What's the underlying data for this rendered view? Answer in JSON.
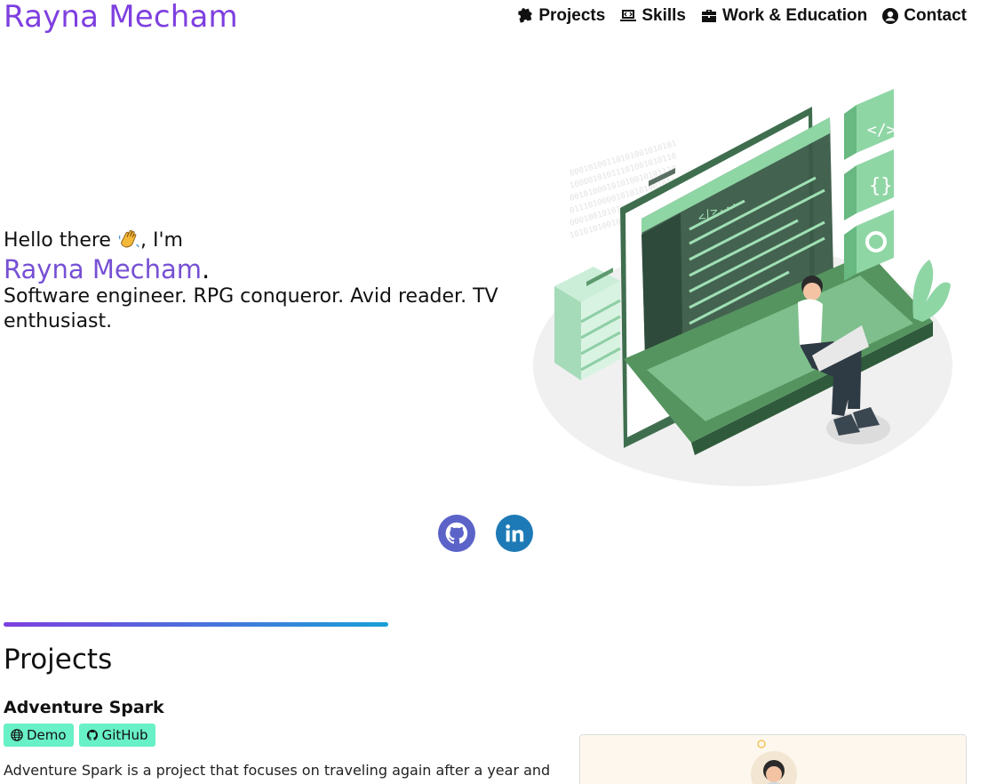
{
  "header": {
    "brand": "Rayna Mecham",
    "nav": [
      {
        "label": "Projects",
        "icon": "puzzle-icon"
      },
      {
        "label": "Skills",
        "icon": "laptop-code-icon"
      },
      {
        "label": "Work & Education",
        "icon": "briefcase-icon"
      },
      {
        "label": "Contact",
        "icon": "user-circle-icon"
      }
    ]
  },
  "hero": {
    "greeting": "Hello there",
    "greeting_suffix": ", I'm",
    "name": "Rayna Mecham",
    "name_suffix": ".",
    "tagline": "Software engineer. RPG conqueror. Avid reader. TV enthusiast."
  },
  "socials": [
    {
      "name": "GitHub",
      "icon": "github-icon",
      "color": "#5b63c9"
    },
    {
      "name": "LinkedIn",
      "icon": "linkedin-icon",
      "color": "#1d7ab6"
    }
  ],
  "projects": {
    "title": "Projects",
    "items": [
      {
        "title": "Adventure Spark",
        "buttons": [
          {
            "label": "Demo",
            "icon": "globe-icon"
          },
          {
            "label": "GitHub",
            "icon": "github-icon"
          }
        ],
        "description": "Adventure Spark is a project that focuses on traveling again after a year and a"
      }
    ]
  },
  "colors": {
    "brand": "#7e3fe0",
    "name": "#7650d4",
    "button_bg": "#68f0c6",
    "divider_start": "#7e3fe0",
    "divider_end": "#1aa0d8"
  }
}
